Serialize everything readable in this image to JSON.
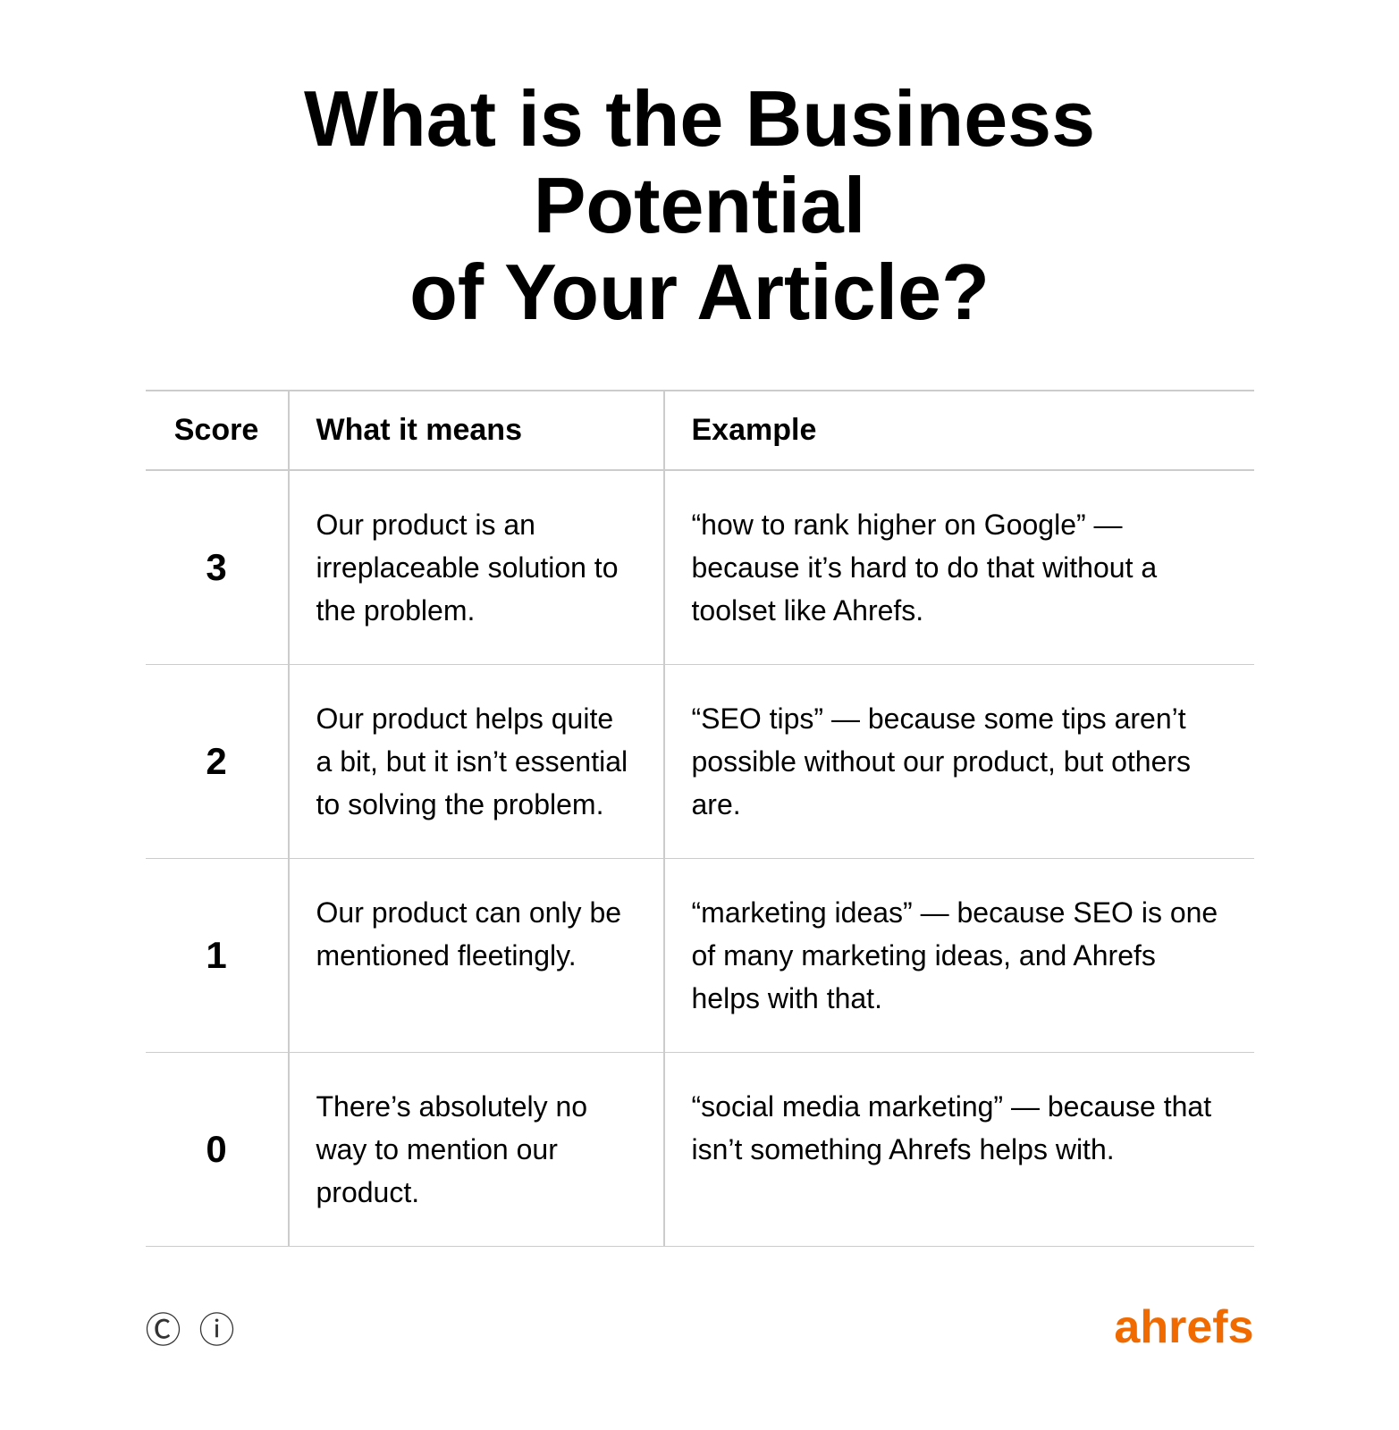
{
  "page": {
    "title_line1": "What is the Business Potential",
    "title_line2": "of Your Article?"
  },
  "table": {
    "headers": {
      "score": "Score",
      "what_it_means": "What it means",
      "example": "Example"
    },
    "rows": [
      {
        "score": "3",
        "what_it_means": "Our product is an irreplaceable solution to the problem.",
        "example": "“how to rank higher on Google” — because it’s hard to do that without a toolset like Ahrefs."
      },
      {
        "score": "2",
        "what_it_means": "Our product helps quite a bit, but it isn’t essential to solving the problem.",
        "example": "“SEO tips” — because some tips aren’t possible without our product, but others are."
      },
      {
        "score": "1",
        "what_it_means": "Our product can only be mentioned fleetingly.",
        "example": "“marketing ideas” — because SEO is one of many marketing ideas, and Ahrefs helps with that."
      },
      {
        "score": "0",
        "what_it_means": "There’s absolutely no way to mention our product.",
        "example": "“social media marketing” — because that isn’t something Ahrefs helps with."
      }
    ]
  },
  "footer": {
    "copyright_icon": "©",
    "info_icon": "ⓘ",
    "logo": "ahrefs"
  }
}
